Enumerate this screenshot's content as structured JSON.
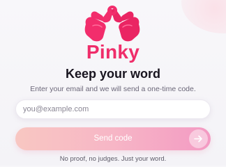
{
  "brand": {
    "name": "Pinky",
    "logo_icon": "pinky-promise-hands-icon",
    "accent_color": "#ef2d6a"
  },
  "headline": "Keep your word",
  "subtitle": "Enter your email and we will send a one-time code.",
  "email_field": {
    "value": "",
    "placeholder": "you@example.com"
  },
  "send_button": {
    "label": "Send code",
    "icon": "arrow-right-icon"
  },
  "footer_note": "No proof, no judges. Just your word."
}
